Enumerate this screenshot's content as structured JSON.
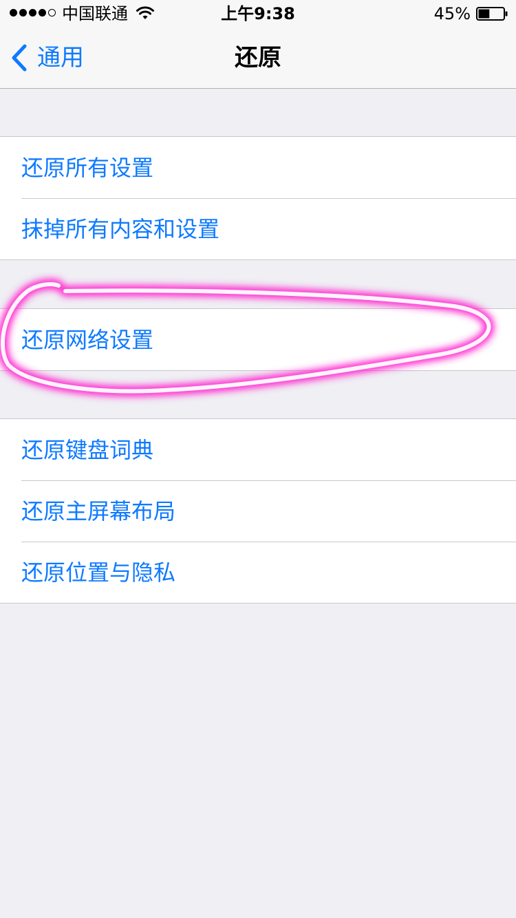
{
  "status_bar": {
    "carrier": "中国联通",
    "time": "上午9:38",
    "battery_percent": "45%",
    "battery_level": 0.45,
    "signal_bars_filled": 4,
    "signal_bars_total": 5
  },
  "nav": {
    "back_label": "通用",
    "title": "还原"
  },
  "groups": [
    {
      "items": [
        {
          "label": "还原所有设置"
        },
        {
          "label": "抹掉所有内容和设置"
        }
      ]
    },
    {
      "items": [
        {
          "label": "还原网络设置"
        }
      ]
    },
    {
      "items": [
        {
          "label": "还原键盘词典"
        },
        {
          "label": "还原主屏幕布局"
        },
        {
          "label": "还原位置与隐私"
        }
      ]
    }
  ],
  "colors": {
    "accent": "#0e7aff",
    "background": "#efeff4",
    "highlight": "#ff2fd0"
  },
  "icons": [
    "back-chevron-icon",
    "wifi-icon",
    "battery-icon",
    "signal-icon"
  ]
}
